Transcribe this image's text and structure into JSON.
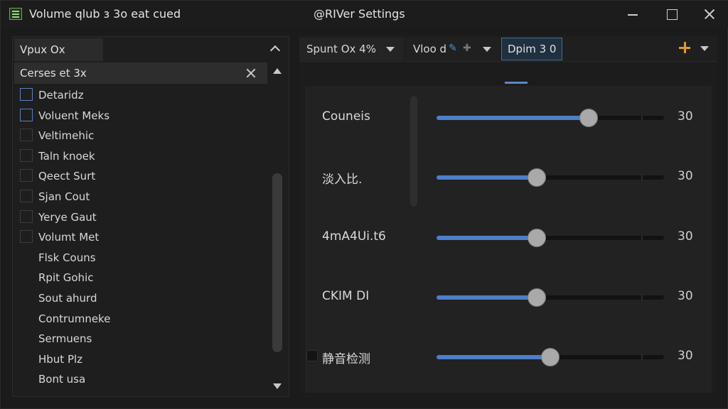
{
  "window": {
    "app_title": "Volume qlub ɜ 3o eat cued",
    "title": "@RIVer Settings",
    "minimize_icon": "minimize-icon",
    "maximize_icon": "maximize-icon",
    "close_icon": "close-icon"
  },
  "left_panel": {
    "header_label": "Vpux Ox",
    "list_header": "Cerses et 3x",
    "items": [
      {
        "label": "Detaridz",
        "checkbox": "blue"
      },
      {
        "label": "Voluent Meks",
        "checkbox": "blue"
      },
      {
        "label": "Veltimehic",
        "checkbox": "dim"
      },
      {
        "label": "Taln knoek",
        "checkbox": "dim"
      },
      {
        "label": "Qeect Surt",
        "checkbox": "dim"
      },
      {
        "label": "Sjan Cout",
        "checkbox": "dim"
      },
      {
        "label": "Yerye Gaut",
        "checkbox": "dim"
      },
      {
        "label": "Volumt Met",
        "checkbox": "dim"
      },
      {
        "label": "Flsk Couns",
        "checkbox": "none"
      },
      {
        "label": "Rpit Gohic",
        "checkbox": "none"
      },
      {
        "label": "Sout ahurd",
        "checkbox": "none"
      },
      {
        "label": "Contrumneke",
        "checkbox": "none"
      },
      {
        "label": "Sermuens",
        "checkbox": "none"
      },
      {
        "label": "Hbut Plz",
        "checkbox": "none"
      },
      {
        "label": "Bont usa",
        "checkbox": "none"
      }
    ]
  },
  "toolbar": {
    "dropdown1": "Spunt Ox 4%",
    "dropdown2": "Vloo d",
    "option_button": "Dpim 3 0",
    "accent_color": "#4d7fc9",
    "plus_color": "#e09a2c"
  },
  "sliders": [
    {
      "label": "Couneis",
      "value_text": "30",
      "fraction": 0.67,
      "has_checkbox": false
    },
    {
      "label": "淡入比.",
      "value_text": "30",
      "fraction": 0.44,
      "has_checkbox": false
    },
    {
      "label": "4mA4Ui.t6",
      "value_text": "30",
      "fraction": 0.44,
      "has_checkbox": false
    },
    {
      "label": "CKIM DI",
      "value_text": "30",
      "fraction": 0.44,
      "has_checkbox": false
    },
    {
      "label": "静音检测",
      "value_text": "30",
      "fraction": 0.5,
      "has_checkbox": true
    }
  ]
}
